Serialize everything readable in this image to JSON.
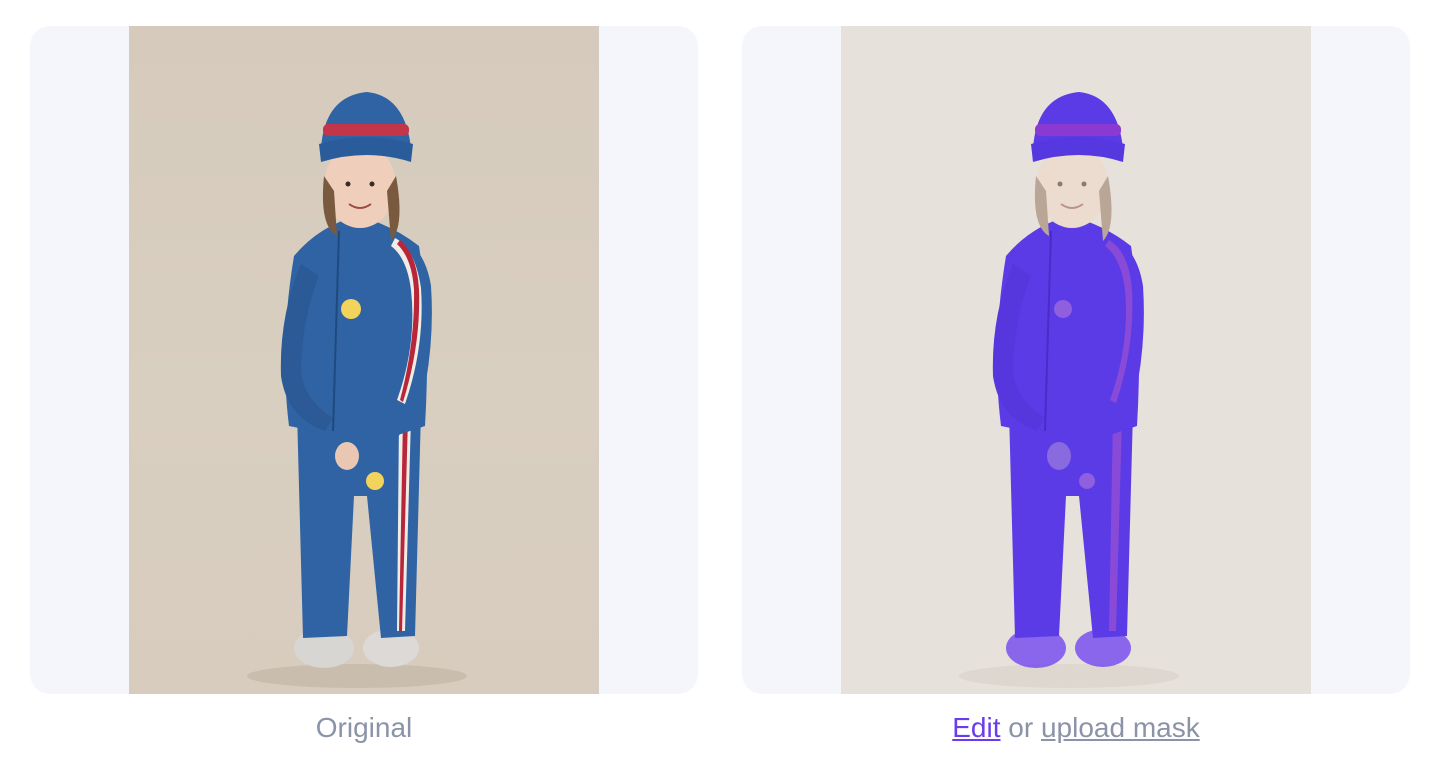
{
  "original": {
    "caption": "Original"
  },
  "mask": {
    "edit_label": "Edit",
    "or_label": "or",
    "upload_label": "upload mask",
    "overlay_color": "#6a3cf0"
  },
  "colors": {
    "panel_bg": "#f5f6fc",
    "caption": "#8a93a8",
    "accent": "#6a3cf0",
    "garment": "#2f63a3",
    "stripe": "#b8263a"
  }
}
